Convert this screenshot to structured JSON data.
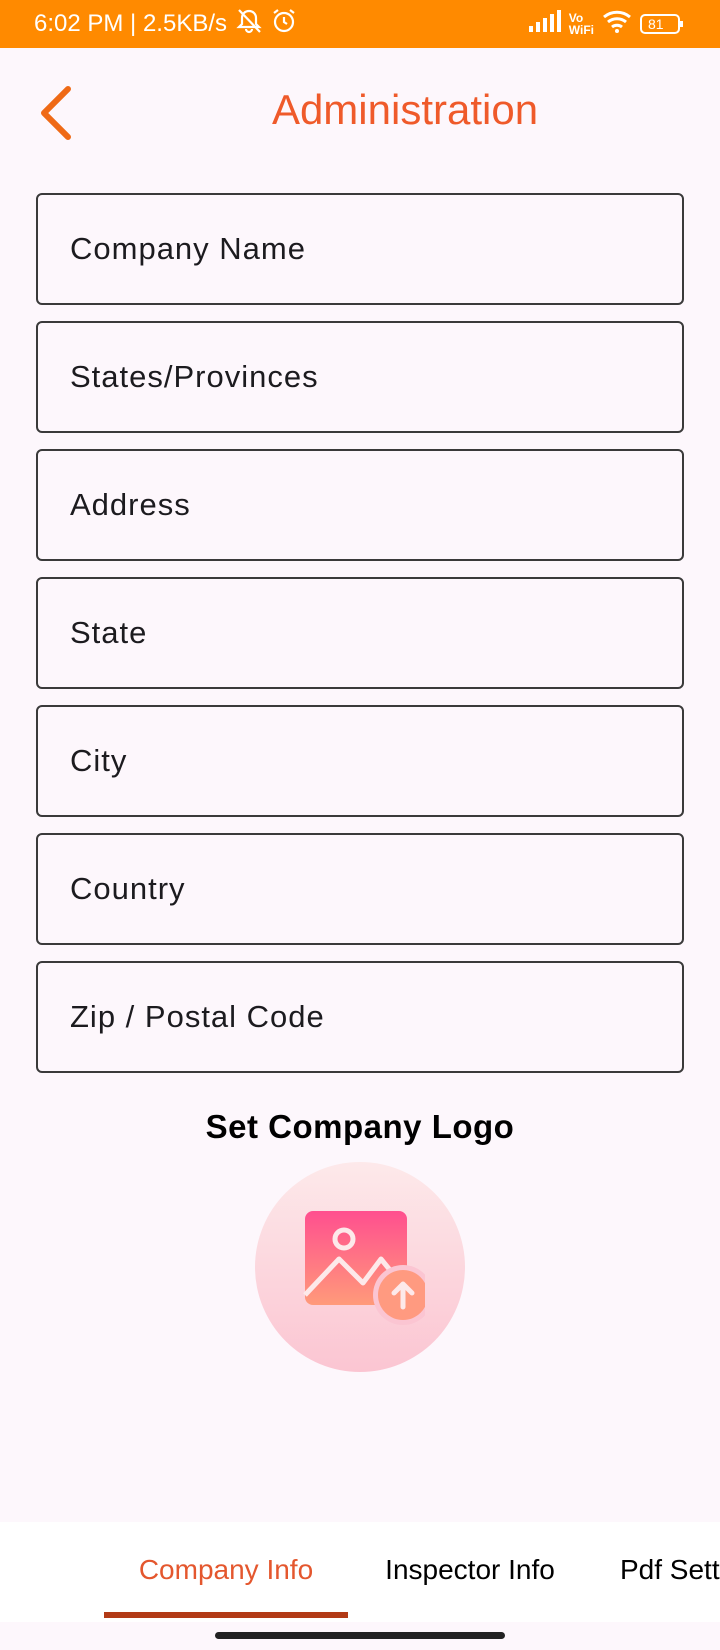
{
  "status_bar": {
    "time_speed": "6:02 PM | 2.5KB/s",
    "battery": "81",
    "network_label_top": "Vo",
    "network_label_bottom": "WiFi"
  },
  "header": {
    "title": "Administration",
    "back_icon": "chevron-left-icon"
  },
  "form": {
    "fields": [
      {
        "placeholder": "Company Name",
        "value": ""
      },
      {
        "placeholder": "States/Provinces",
        "value": ""
      },
      {
        "placeholder": "Address",
        "value": ""
      },
      {
        "placeholder": "State",
        "value": ""
      },
      {
        "placeholder": "City",
        "value": ""
      },
      {
        "placeholder": "Country",
        "value": ""
      },
      {
        "placeholder": "Zip / Postal Code",
        "value": ""
      }
    ]
  },
  "logo_section": {
    "heading": "Set Company Logo",
    "icon": "image-upload-icon"
  },
  "tabs": [
    {
      "label": "Company Info",
      "active": true
    },
    {
      "label": "Inspector Info",
      "active": false
    },
    {
      "label": "Pdf Settings",
      "active": false
    }
  ],
  "colors": {
    "status_bar": "#ff8a00",
    "accent": "#ef5a2a",
    "tab_indicator": "#b23a16"
  }
}
